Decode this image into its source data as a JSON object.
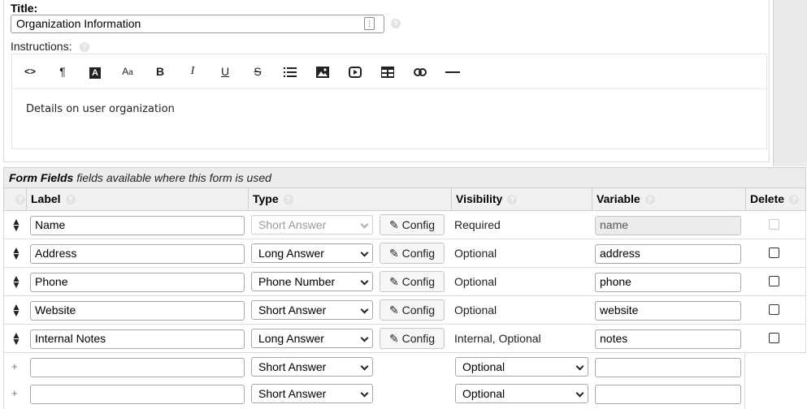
{
  "form": {
    "title_label": "Title:",
    "title_value": "Organization Information",
    "instructions_label": "Instructions:",
    "instructions_text": "Details on user organization"
  },
  "toolbar": {
    "buttons": [
      {
        "name": "code-view-button",
        "glyph": "<>"
      },
      {
        "name": "paragraph-button",
        "glyph": "¶"
      },
      {
        "name": "text-color-button",
        "glyph": "A"
      },
      {
        "name": "font-size-button",
        "glyph": "Aa"
      },
      {
        "name": "bold-button",
        "glyph": "B"
      },
      {
        "name": "italic-button",
        "glyph": "I"
      },
      {
        "name": "underline-button",
        "glyph": "U"
      },
      {
        "name": "strikethrough-button",
        "glyph": "S"
      },
      {
        "name": "list-button",
        "glyph": "≡"
      },
      {
        "name": "image-button",
        "glyph": "▨"
      },
      {
        "name": "video-button",
        "glyph": "▶"
      },
      {
        "name": "table-button",
        "glyph": "▦"
      },
      {
        "name": "link-button",
        "glyph": "⊂⊃"
      },
      {
        "name": "horizontal-rule-button",
        "glyph": "—"
      }
    ]
  },
  "form_fields": {
    "header_title": "Form Fields",
    "header_subtitle": "fields available where this form is used",
    "columns": {
      "label": "Label",
      "type": "Type",
      "visibility": "Visibility",
      "variable": "Variable",
      "delete": "Delete"
    },
    "config_label": "Config",
    "rows": [
      {
        "label": "Name",
        "type": "Short Answer",
        "type_disabled": true,
        "visibility": "Required",
        "variable": "name",
        "variable_disabled": true,
        "delete_disabled": true
      },
      {
        "label": "Address",
        "type": "Long Answer",
        "visibility": "Optional",
        "variable": "address"
      },
      {
        "label": "Phone",
        "type": "Phone Number",
        "visibility": "Optional",
        "variable": "phone"
      },
      {
        "label": "Website",
        "type": "Short Answer",
        "visibility": "Optional",
        "variable": "website"
      },
      {
        "label": "Internal Notes",
        "type": "Long Answer",
        "visibility": "Internal, Optional",
        "variable": "notes"
      }
    ],
    "new_rows": [
      {
        "label": "",
        "type": "Short Answer",
        "visibility": "Optional",
        "variable": ""
      },
      {
        "label": "",
        "type": "Short Answer",
        "visibility": "Optional",
        "variable": ""
      }
    ]
  }
}
